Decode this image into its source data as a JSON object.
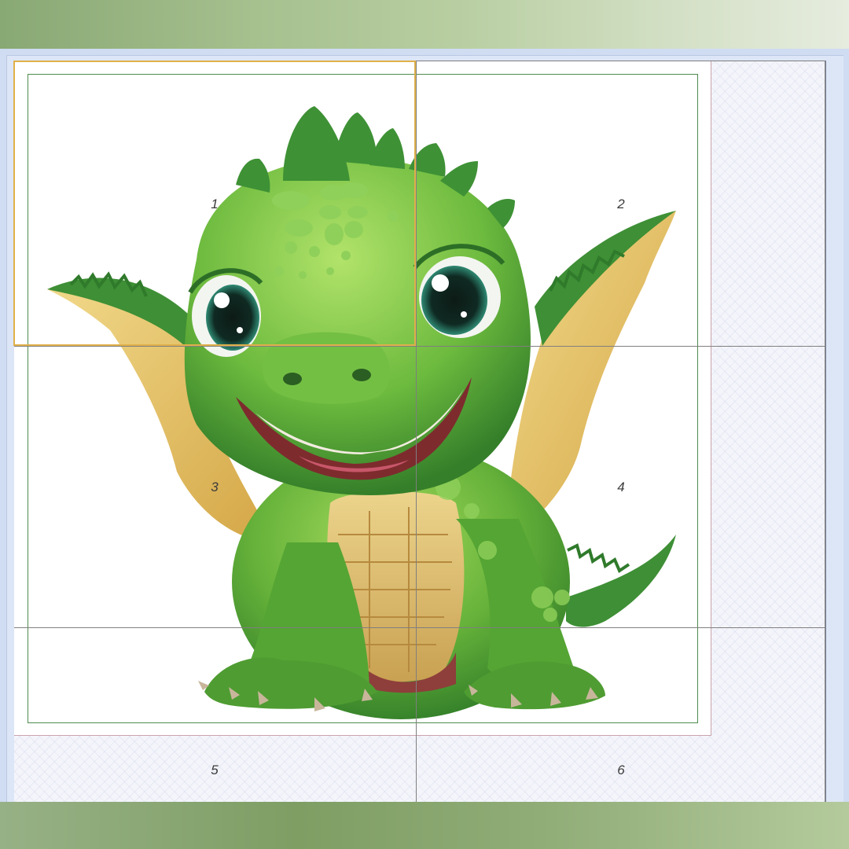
{
  "tiles": [
    {
      "number": "1"
    },
    {
      "number": "2"
    },
    {
      "number": "3"
    },
    {
      "number": "4"
    },
    {
      "number": "5"
    },
    {
      "number": "6"
    }
  ],
  "selected_tile": "1",
  "colors": {
    "selection": "#e0b04a",
    "margin_frame": "#4f8a4f",
    "grid_lines": "#7f7f7f",
    "dragon_body": "#5faa3a",
    "dragon_wing": "#e7c566"
  },
  "image_subject": "dragon-illustration"
}
